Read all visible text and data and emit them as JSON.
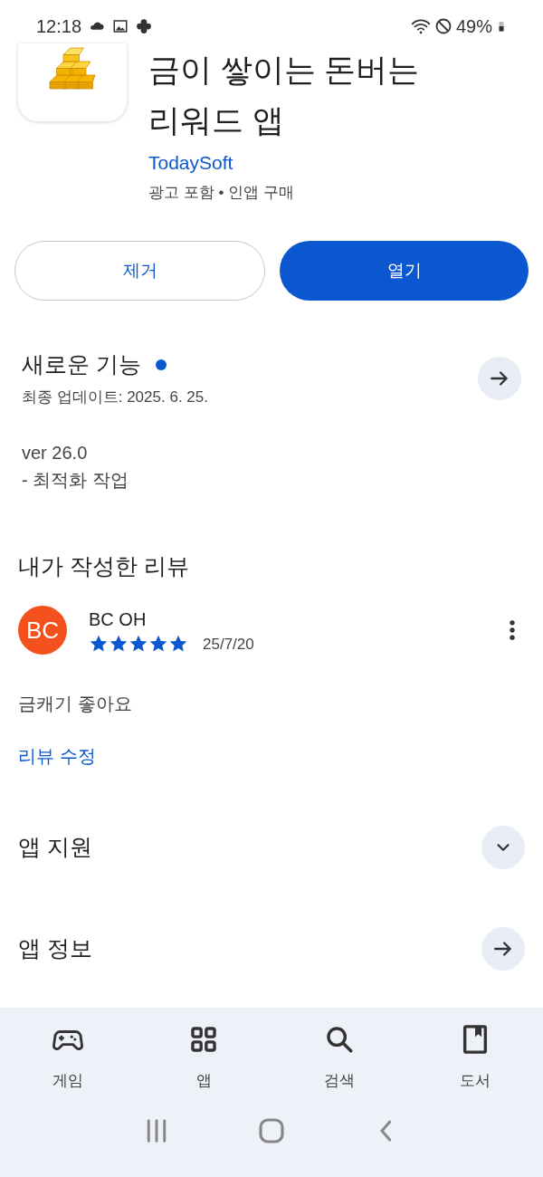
{
  "status_bar": {
    "time": "12:18",
    "battery": "49%"
  },
  "app": {
    "title_lines": [
      "금이 쌓이는 돈버는",
      "리워드 앱"
    ],
    "developer": "TodaySoft",
    "notes": "광고 포함 • 인앱 구매"
  },
  "buttons": [
    {
      "label": "제거",
      "kind": "outline"
    },
    {
      "label": "열기",
      "kind": "filled"
    }
  ],
  "whats_new": {
    "title": "새로운 기능",
    "updated": "최종 업데이트: 2025. 6. 25.",
    "lines": [
      "ver 26.0",
      "- 최적화 작업"
    ]
  },
  "my_review": {
    "title": "내가 작성한 리뷰",
    "avatar": "BC",
    "author": "BC OH",
    "stars": 5,
    "date": "25/7/20",
    "text": "금캐기 좋아요",
    "edit_link": "리뷰 수정"
  },
  "sections": [
    {
      "title": "앱 지원",
      "kind": "expand"
    },
    {
      "title": "앱 정보",
      "kind": "arrow"
    }
  ],
  "bottom_nav": [
    {
      "label": "게임",
      "kind": "games"
    },
    {
      "label": "앱",
      "kind": "apps"
    },
    {
      "label": "검색",
      "kind": "search"
    },
    {
      "label": "도서",
      "kind": "books"
    }
  ]
}
